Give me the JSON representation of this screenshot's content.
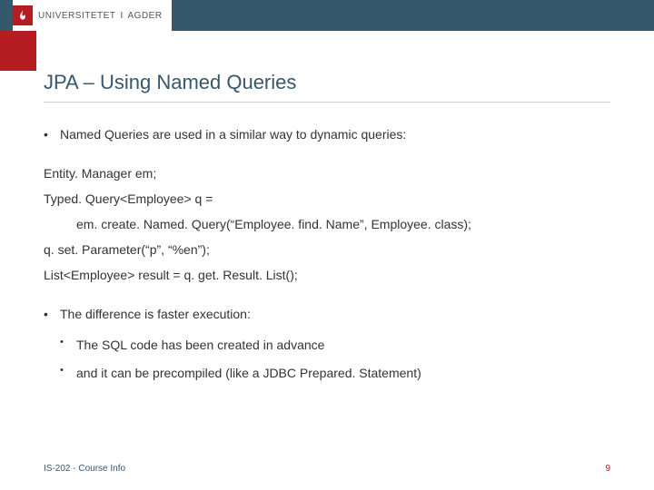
{
  "header": {
    "institution_part1": "UNIVERSITETET",
    "institution_divider": "I",
    "institution_part2": "AGDER"
  },
  "title": "JPA – Using Named Queries",
  "bullets": {
    "intro": "Named Queries are used in a similar way to dynamic queries:",
    "diff": "The difference is faster execution:",
    "sub1": "The SQL code has been created in advance",
    "sub2": "and it can be precompiled (like a JDBC Prepared. Statement)"
  },
  "code": {
    "line1": "Entity. Manager em;",
    "line2": "Typed. Query<Employee> q =",
    "line3": "em. create. Named. Query(“Employee. find. Name”, Employee. class);",
    "line4": "q. set. Parameter(“p”, “%en”);",
    "line5": "List<Employee> result = q. get. Result. List();"
  },
  "footer": {
    "left": "IS-202 - Course Info",
    "page": "9"
  }
}
